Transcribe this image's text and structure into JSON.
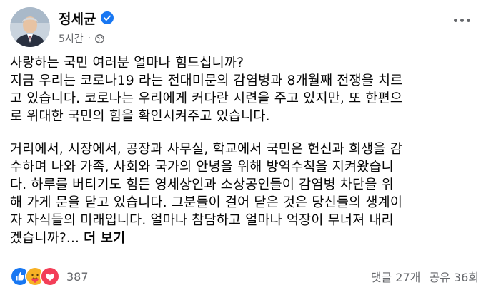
{
  "post": {
    "author": "정세균",
    "verified_icon": "verified-badge-icon",
    "time": "5시간",
    "separator": "·",
    "audience_icon": "globe-icon",
    "lines_p1": [
      "사랑하는 국민 여러분 얼마나 힘드십니까?",
      "지금 우리는 코로나19 라는 전대미문의 감염병과 8개월째 전쟁을 치르",
      "고 있습니다. 코로나는 우리에게 커다란 시련을 주고 있지만, 또 한편으",
      "로 위대한 국민의 힘을 확인시켜주고 있습니다."
    ],
    "lines_p2": [
      "거리에서, 시장에서, 공장과 사무실, 학교에서 국민은 헌신과 희생을 감",
      "수하며 나와 가족, 사회와 국가의 안녕을 위해 방역수칙을 지켜왔습니",
      "다. 하루를 버티기도 힘든 영세상인과 소상공인들이 감염병 차단을 위",
      "해 가게 문을 닫고 있습니다. 그분들이 걸어 닫은 것은 당신들의 생계이",
      "자 자식들의 미래입니다. 얼마나 참담하고 얼마나 억장이 무너져 내리",
      "겠습니까?..."
    ],
    "see_more": "더 보기"
  },
  "footer": {
    "reaction_count": "387",
    "comments": "댓글 27개",
    "shares": "공유 36회"
  },
  "colors": {
    "accent": "#1877f2",
    "secondary_text": "#65676b",
    "like": "#1877f2",
    "love": "#f33e58",
    "care": "#f7b125"
  }
}
